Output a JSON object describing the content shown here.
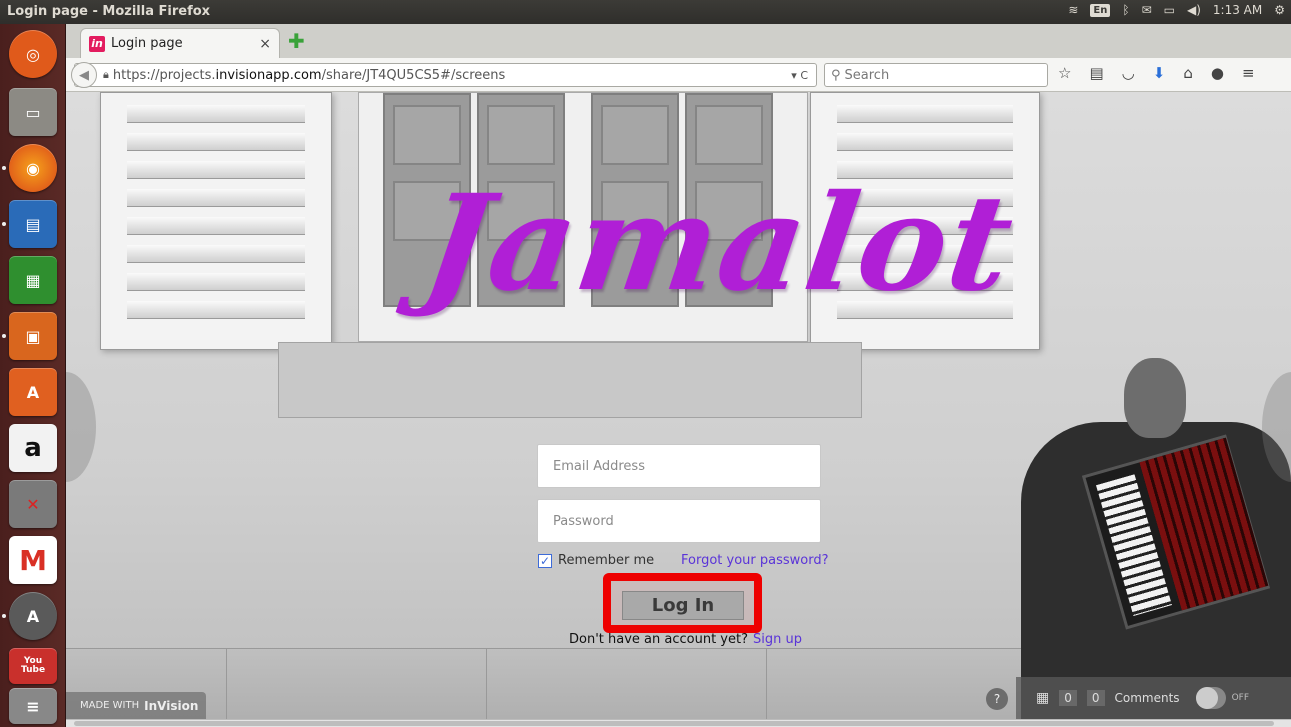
{
  "window": {
    "title": "Login page - Mozilla Firefox"
  },
  "tray": {
    "keyboard_layout": "En",
    "time": "1:13 AM"
  },
  "launcher": {
    "items": [
      {
        "name": "ubuntu-dash-icon",
        "glyph": "◎",
        "color": "#e05a1b"
      },
      {
        "name": "files-icon",
        "glyph": "▭",
        "color": "#8c8a84"
      },
      {
        "name": "firefox-icon",
        "glyph": "◉",
        "color": "#e8721c"
      },
      {
        "name": "writer-icon",
        "glyph": "▤",
        "color": "#2a6bb8"
      },
      {
        "name": "calc-icon",
        "glyph": "▦",
        "color": "#2f8f2f"
      },
      {
        "name": "impress-icon",
        "glyph": "▣",
        "color": "#d9661e"
      },
      {
        "name": "software-center-icon",
        "glyph": "A",
        "color": "#e06020"
      },
      {
        "name": "amazon-icon",
        "glyph": "a",
        "color": "#f2f2f2"
      },
      {
        "name": "settings-icon",
        "glyph": "✕",
        "color": "#7a7a7a"
      },
      {
        "name": "gmail-icon",
        "glyph": "M",
        "color": "#ffffff"
      },
      {
        "name": "software-updater-icon",
        "glyph": "A",
        "color": "#5a5a5a"
      },
      {
        "name": "youtube-icon",
        "glyph": "You\nTube",
        "color": "#c9302c"
      }
    ]
  },
  "browser": {
    "tab": {
      "label": "Login page",
      "favicon": "in"
    },
    "url": {
      "prefix": "https://projects.",
      "domain": "invisionapp.com",
      "path": "/share/JT4QU5CS5#/screens"
    },
    "search_placeholder": "Search"
  },
  "page": {
    "logo_text": "Jamalot",
    "email_placeholder": "Email Address",
    "password_placeholder": "Password",
    "remember_label": "Remember me",
    "remember_checked": true,
    "forgot_link": "Forgot your password?",
    "login_button": "Log In",
    "no_account_text": "Don't have an account yet?",
    "signup_link": "Sign up",
    "made_with_text": "MADE WITH",
    "made_with_brand": "InVision",
    "comments": {
      "count_a": "0",
      "count_b": "0",
      "label": "Comments",
      "toggle_label": "OFF"
    },
    "help_label": "?"
  },
  "colors": {
    "logo": "#b01fd6",
    "highlight": "#ee0000",
    "link": "#5a34d8"
  }
}
